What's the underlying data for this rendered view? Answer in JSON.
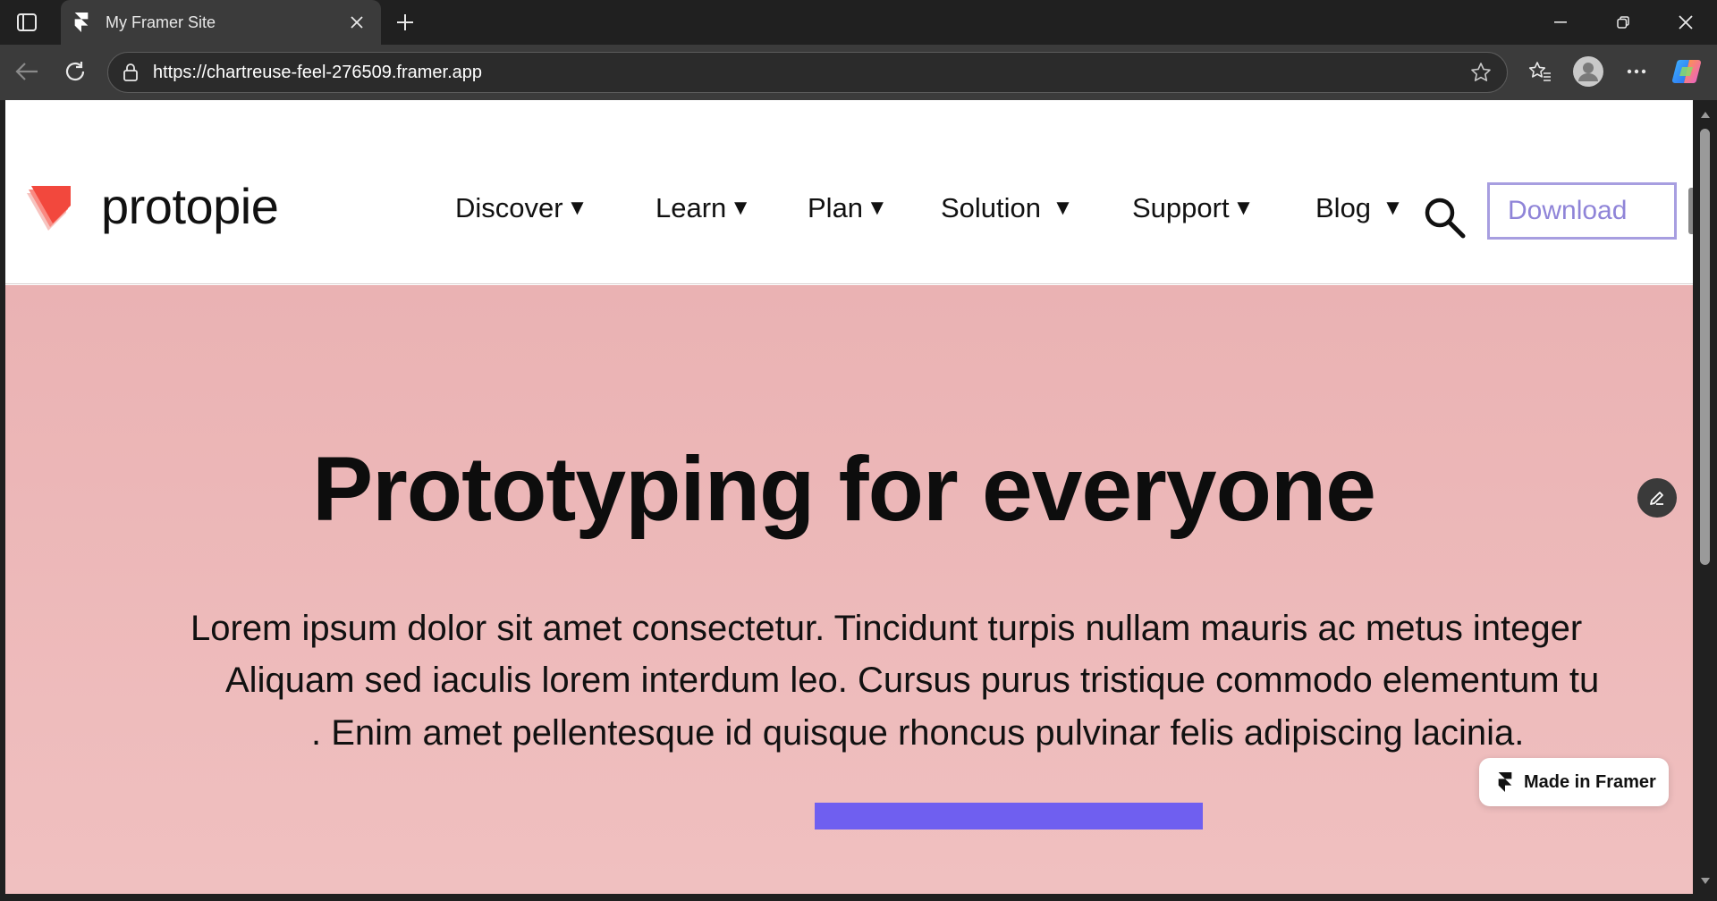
{
  "browser": {
    "tab_title": "My Framer Site",
    "url": "https://chartreuse-feel-276509.framer.app"
  },
  "site": {
    "logo_text": "protopie",
    "nav": [
      {
        "label": "Discover",
        "caret": "▼"
      },
      {
        "label": "Learn",
        "caret": "▼"
      },
      {
        "label": "Plan",
        "caret": "▼"
      },
      {
        "label": "Solution ",
        "caret": "▼"
      },
      {
        "label": "Support",
        "caret": "▼"
      },
      {
        "label": "Blog ",
        "caret": "▼"
      }
    ],
    "download_label": "Download"
  },
  "hero": {
    "title": "Prototyping for everyone",
    "lines": [
      "Lorem ipsum dolor sit amet consectetur. Tincidunt turpis nullam mauris ac metus integer",
      "Aliquam sed iaculis lorem interdum leo. Cursus purus tristique commodo elementum tu",
      ". Enim amet pellentesque id quisque rhoncus pulvinar felis adipiscing lacinia."
    ]
  },
  "badge": {
    "label": "Made in Framer"
  },
  "colors": {
    "accent": "#6f5ff0",
    "hero_top": "#eab2b3",
    "hero_bottom": "#f0c0c0",
    "download_border": "#a79ee0",
    "logo_red": "#f2483d"
  }
}
